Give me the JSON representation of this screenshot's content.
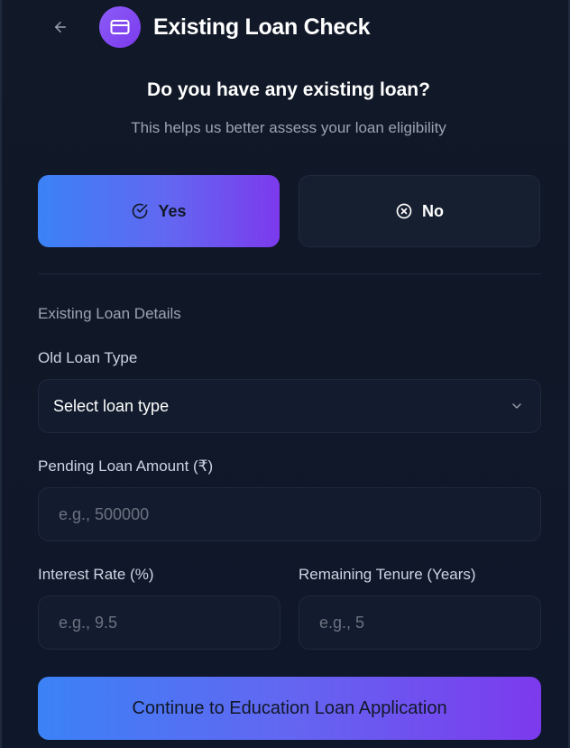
{
  "header": {
    "title": "Existing Loan Check",
    "back_icon": "arrow-left-icon",
    "title_icon": "credit-card-icon"
  },
  "question": {
    "title": "Do you have any existing loan?",
    "subtitle": "This helps us better assess your loan eligibility"
  },
  "choices": {
    "yes": {
      "label": "Yes",
      "icon": "check-circle-icon",
      "selected": true
    },
    "no": {
      "label": "No",
      "icon": "x-circle-icon",
      "selected": false
    }
  },
  "details": {
    "section_title": "Existing Loan Details",
    "loan_type": {
      "label": "Old Loan Type",
      "value": "Select loan type"
    },
    "pending_amount": {
      "label": "Pending Loan Amount (₹)",
      "placeholder": "e.g., 500000"
    },
    "interest_rate": {
      "label": "Interest Rate (%)",
      "placeholder": "e.g., 9.5"
    },
    "remaining_tenure": {
      "label": "Remaining Tenure (Years)",
      "placeholder": "e.g., 5"
    }
  },
  "cta": {
    "label": "Continue to Education Loan Application"
  },
  "colors": {
    "accent_start": "#3b82f6",
    "accent_end": "#7c3aed",
    "background": "#111827",
    "field": "#131c2e"
  }
}
